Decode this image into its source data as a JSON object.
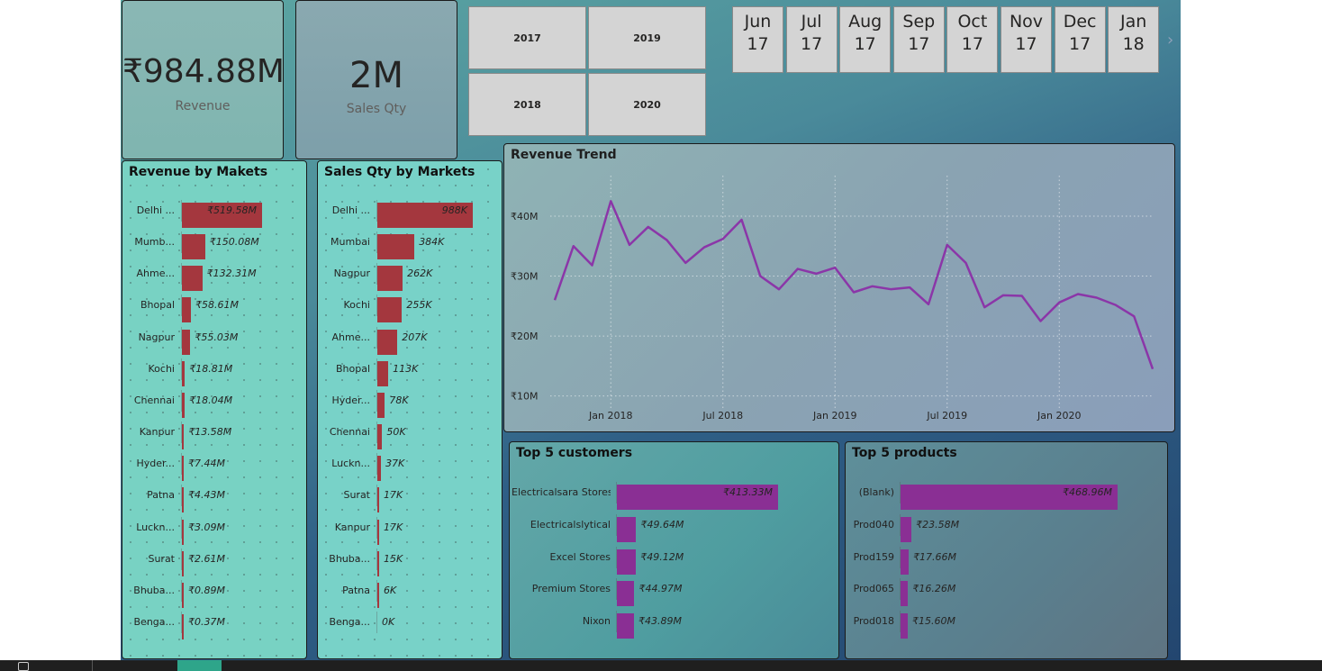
{
  "kpis": {
    "revenue": {
      "value": "₹984.88M",
      "label": "Revenue"
    },
    "sales_qty": {
      "value": "2M",
      "label": "Sales Qty"
    }
  },
  "year_slicer": [
    "2017",
    "2019",
    "2018",
    "2020"
  ],
  "month_slicer": [
    {
      "m": "Jun",
      "y": "17"
    },
    {
      "m": "Jul",
      "y": "17"
    },
    {
      "m": "Aug",
      "y": "17"
    },
    {
      "m": "Sep",
      "y": "17"
    },
    {
      "m": "Oct",
      "y": "17"
    },
    {
      "m": "Nov",
      "y": "17"
    },
    {
      "m": "Dec",
      "y": "17"
    },
    {
      "m": "Jan",
      "y": "18"
    }
  ],
  "scroll_icon": "chevron-right-icon",
  "colors": {
    "bar_red": "#a4373e",
    "bar_purple": "#8a2f94",
    "line": "#8b36a8"
  },
  "revenue_by_markets": {
    "title": "Revenue by Makets",
    "items": [
      {
        "label": "Delhi ...",
        "value": 519.58,
        "text": "₹519.58M"
      },
      {
        "label": "Mumb...",
        "value": 150.08,
        "text": "₹150.08M"
      },
      {
        "label": "Ahme...",
        "value": 132.31,
        "text": "₹132.31M"
      },
      {
        "label": "Bhopal",
        "value": 58.61,
        "text": "₹58.61M"
      },
      {
        "label": "Nagpur",
        "value": 55.03,
        "text": "₹55.03M"
      },
      {
        "label": "Kochi",
        "value": 18.81,
        "text": "₹18.81M"
      },
      {
        "label": "Chennai",
        "value": 18.04,
        "text": "₹18.04M"
      },
      {
        "label": "Kanpur",
        "value": 13.58,
        "text": "₹13.58M"
      },
      {
        "label": "Hyder...",
        "value": 7.44,
        "text": "₹7.44M"
      },
      {
        "label": "Patna",
        "value": 4.43,
        "text": "₹4.43M"
      },
      {
        "label": "Luckn...",
        "value": 3.09,
        "text": "₹3.09M"
      },
      {
        "label": "Surat",
        "value": 2.61,
        "text": "₹2.61M"
      },
      {
        "label": "Bhuba...",
        "value": 0.89,
        "text": "₹0.89M"
      },
      {
        "label": "Benga...",
        "value": 0.37,
        "text": "₹0.37M"
      }
    ]
  },
  "sales_qty_by_markets": {
    "title": "Sales Qty by Markets",
    "items": [
      {
        "label": "Delhi ...",
        "value": 988,
        "text": "988K"
      },
      {
        "label": "Mumbai",
        "value": 384,
        "text": "384K"
      },
      {
        "label": "Nagpur",
        "value": 262,
        "text": "262K"
      },
      {
        "label": "Kochi",
        "value": 255,
        "text": "255K"
      },
      {
        "label": "Ahme...",
        "value": 207,
        "text": "207K"
      },
      {
        "label": "Bhopal",
        "value": 113,
        "text": "113K"
      },
      {
        "label": "Hyder...",
        "value": 78,
        "text": "78K"
      },
      {
        "label": "Chennai",
        "value": 50,
        "text": "50K"
      },
      {
        "label": "Luckn...",
        "value": 37,
        "text": "37K"
      },
      {
        "label": "Surat",
        "value": 17,
        "text": "17K"
      },
      {
        "label": "Kanpur",
        "value": 17,
        "text": "17K"
      },
      {
        "label": "Bhuba...",
        "value": 15,
        "text": "15K"
      },
      {
        "label": "Patna",
        "value": 6,
        "text": "6K"
      },
      {
        "label": "Benga...",
        "value": 0,
        "text": "0K"
      }
    ]
  },
  "top_customers": {
    "title": "Top 5 customers",
    "items": [
      {
        "label": "Electricalsara Stores",
        "value": 413.33,
        "text": "₹413.33M"
      },
      {
        "label": "Electricalslytical",
        "value": 49.64,
        "text": "₹49.64M"
      },
      {
        "label": "Excel Stores",
        "value": 49.12,
        "text": "₹49.12M"
      },
      {
        "label": "Premium Stores",
        "value": 44.97,
        "text": "₹44.97M"
      },
      {
        "label": "Nixon",
        "value": 43.89,
        "text": "₹43.89M"
      }
    ]
  },
  "top_products": {
    "title": "Top 5 products",
    "items": [
      {
        "label": "(Blank)",
        "value": 468.96,
        "text": "₹468.96M"
      },
      {
        "label": "Prod040",
        "value": 23.58,
        "text": "₹23.58M"
      },
      {
        "label": "Prod159",
        "value": 17.66,
        "text": "₹17.66M"
      },
      {
        "label": "Prod065",
        "value": 16.26,
        "text": "₹16.26M"
      },
      {
        "label": "Prod018",
        "value": 15.6,
        "text": "₹15.60M"
      }
    ]
  },
  "chart_data": {
    "type": "line",
    "title": "Revenue Trend",
    "xlabel": "",
    "ylabel": "",
    "x": [
      "2017-10",
      "2017-11",
      "2017-12",
      "2018-01",
      "2018-02",
      "2018-03",
      "2018-04",
      "2018-05",
      "2018-06",
      "2018-07",
      "2018-08",
      "2018-09",
      "2018-10",
      "2018-11",
      "2018-12",
      "2019-01",
      "2019-02",
      "2019-03",
      "2019-04",
      "2019-05",
      "2019-06",
      "2019-07",
      "2019-08",
      "2019-09",
      "2019-10",
      "2019-11",
      "2019-12",
      "2020-01",
      "2020-02",
      "2020-03",
      "2020-04",
      "2020-05",
      "2020-06"
    ],
    "x_ticks": [
      "Jan 2018",
      "Jul 2018",
      "Jan 2019",
      "Jul 2019",
      "Jan 2020"
    ],
    "x_tick_positions": [
      "2018-01",
      "2018-07",
      "2019-01",
      "2019-07",
      "2020-01"
    ],
    "y_ticks": [
      "₹10M",
      "₹20M",
      "₹30M",
      "₹40M"
    ],
    "y_tick_values": [
      10,
      20,
      30,
      40
    ],
    "ylim": [
      8,
      46
    ],
    "series": [
      {
        "values": [
          26,
          35,
          31.8,
          42.5,
          35.2,
          38.2,
          36,
          32.2,
          34.8,
          36.2,
          39.4,
          30,
          27.8,
          31.2,
          30.4,
          31.4,
          27.3,
          28.3,
          27.8,
          28.1,
          25.3,
          35.2,
          32.2,
          24.8,
          26.8,
          26.7,
          22.5,
          25.6,
          27,
          26.4,
          25.2,
          23.3,
          14.5
        ]
      }
    ],
    "grid": true
  }
}
